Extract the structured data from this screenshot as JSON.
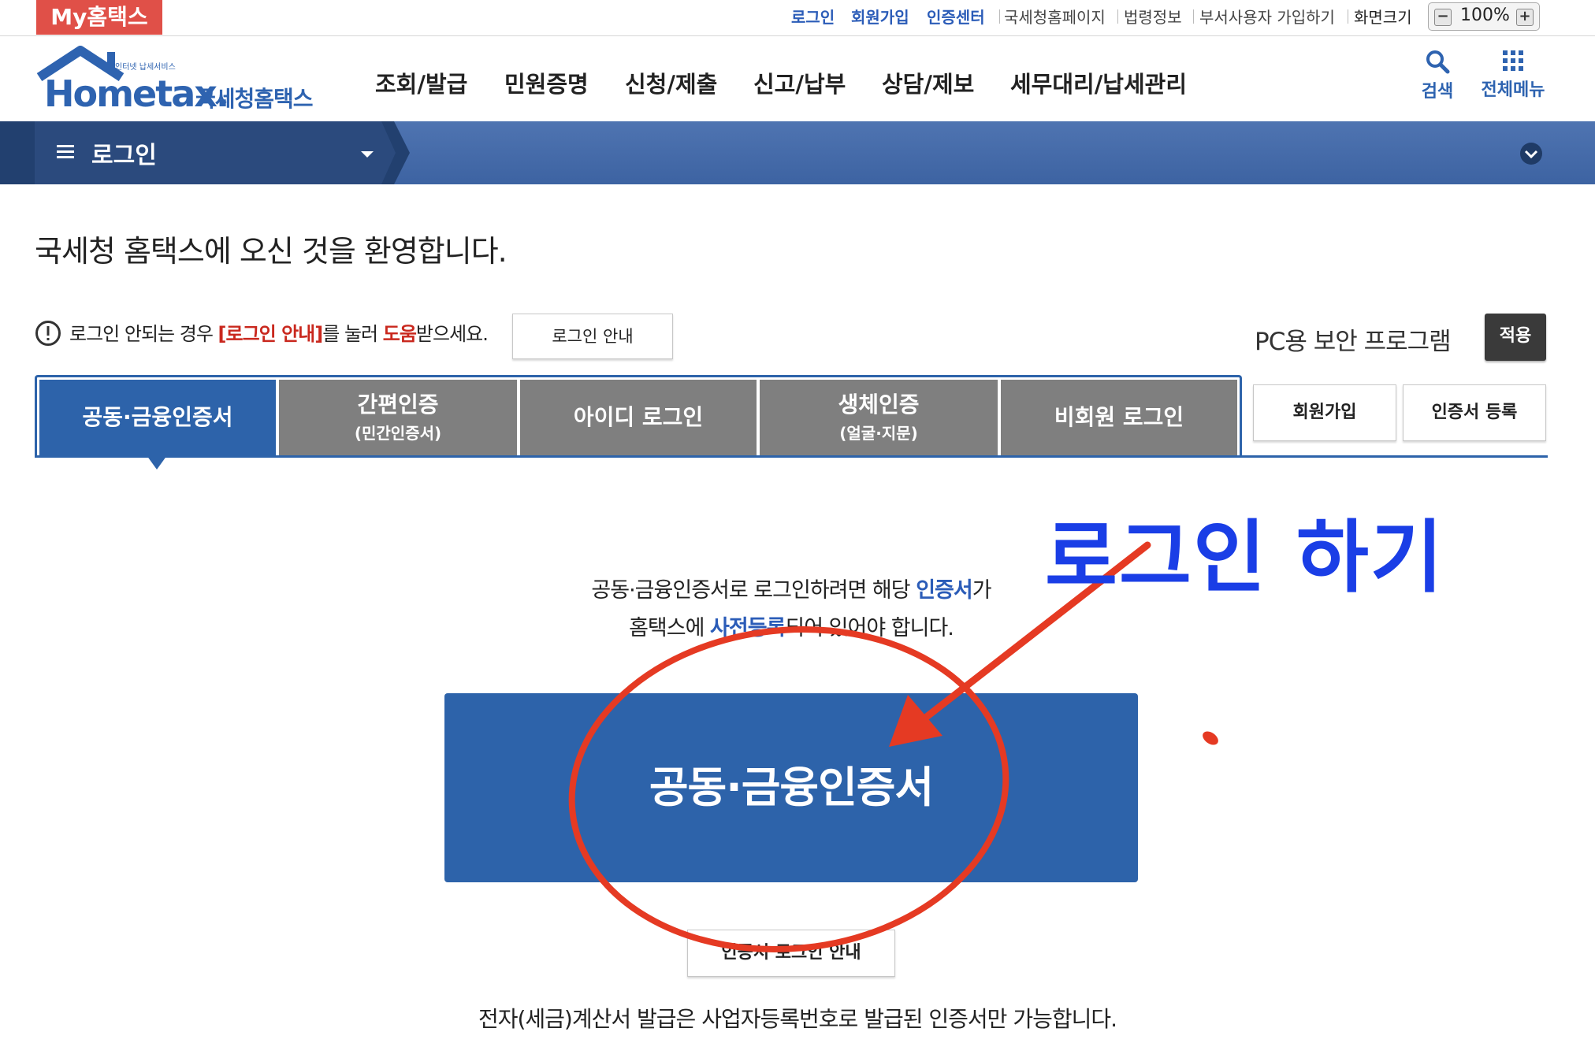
{
  "topbar": {
    "my_hometax": "My홈택스",
    "login": "로그인",
    "signup": "회원가입",
    "cert_center": "인증센터",
    "nts_homepage": "국세청홈페이지",
    "law_info": "법령정보",
    "dept_user_signup": "부서사용자 가입하기",
    "screen_size": "화면크기",
    "zoom_minus": "−",
    "zoom_value": "100%",
    "zoom_plus": "+"
  },
  "header": {
    "logo_small": "인터넷 납세서비스",
    "logo_text": "Hometax.",
    "logo_korean": "국세청홈택스",
    "menu": [
      "조회/발급",
      "민원증명",
      "신청/제출",
      "신고/납부",
      "상담/제보",
      "세무대리/납세관리"
    ],
    "search_label": "검색",
    "all_menu_label": "전체메뉴"
  },
  "navbar": {
    "current": "로그인"
  },
  "content": {
    "welcome": "국세청 홈택스에 오신 것을 환영합니다.",
    "notice_prefix": "로그인 안되는 경우 ",
    "notice_link": "[로그인 안내]",
    "notice_mid": "를 눌러 ",
    "notice_help": "도움",
    "notice_suffix": "받으세요.",
    "login_guide_button": "로그인 안내",
    "security_label": "PC용 보안 프로그램",
    "apply_button": "적용"
  },
  "tabs": [
    {
      "label": "공동·금융인증서",
      "sub": ""
    },
    {
      "label": "간편인증",
      "sub": "(민간인증서)"
    },
    {
      "label": "아이디 로그인",
      "sub": ""
    },
    {
      "label": "생체인증",
      "sub": "(얼굴·지문)"
    },
    {
      "label": "비회원 로그인",
      "sub": ""
    }
  ],
  "side_buttons": {
    "signup": "회원가입",
    "cert_register": "인증서 등록"
  },
  "cert_panel": {
    "line1_prefix": "공동·금융인증서로 로그인하려면 해당 ",
    "line1_highlight": "인증서",
    "line1_suffix": "가",
    "line2_prefix": "홈택스에 ",
    "line2_highlight": "사전등록",
    "line2_suffix": "되어 있어야 합니다.",
    "main_button": "공동·금융인증서",
    "guide_button": "인증서 로그인 안내",
    "bottom_note": "전자(세금)계산서 발급은 사업자등록번호로 발급된 인증서만 가능합니다."
  },
  "annotation": {
    "text": "로그인 하기",
    "color": "#1a3ee6",
    "marker_color": "#e53a23"
  },
  "colors": {
    "primary_blue": "#2d63aa",
    "tab_gray": "#7f7f7f",
    "link_blue": "#2b5cb8",
    "alert_red": "#c9281e"
  }
}
